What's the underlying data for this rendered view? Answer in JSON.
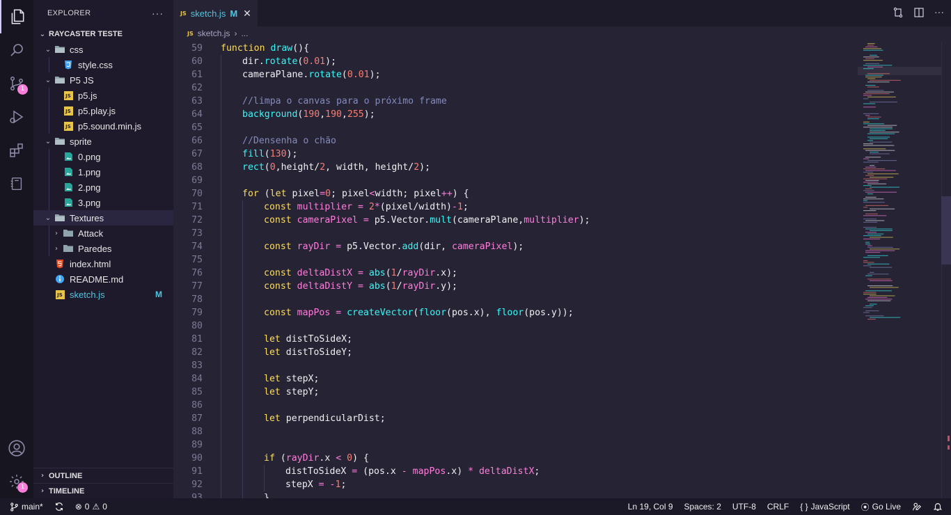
{
  "explorer": {
    "title": "EXPLORER",
    "more": "···",
    "workspace": "RAYCASTER TESTE",
    "tree": [
      {
        "name": "css",
        "kind": "folder-open",
        "depth": 1
      },
      {
        "name": "style.css",
        "kind": "css",
        "depth": 2
      },
      {
        "name": "P5 JS",
        "kind": "folder-open",
        "depth": 1
      },
      {
        "name": "p5.js",
        "kind": "js",
        "depth": 2
      },
      {
        "name": "p5.play.js",
        "kind": "js",
        "depth": 2
      },
      {
        "name": "p5.sound.min.js",
        "kind": "js",
        "depth": 2
      },
      {
        "name": "sprite",
        "kind": "folder-open",
        "depth": 1
      },
      {
        "name": "0.png",
        "kind": "png",
        "depth": 2
      },
      {
        "name": "1.png",
        "kind": "png",
        "depth": 2
      },
      {
        "name": "2.png",
        "kind": "png",
        "depth": 2
      },
      {
        "name": "3.png",
        "kind": "png",
        "depth": 2
      },
      {
        "name": "Textures",
        "kind": "folder-open",
        "depth": 1,
        "selected": true
      },
      {
        "name": "Attack",
        "kind": "folder",
        "depth": 2
      },
      {
        "name": "Paredes",
        "kind": "folder",
        "depth": 2
      },
      {
        "name": "index.html",
        "kind": "html",
        "depth": 1
      },
      {
        "name": "README.md",
        "kind": "info",
        "depth": 1
      },
      {
        "name": "sketch.js",
        "kind": "js",
        "depth": 1,
        "modified": "M"
      }
    ],
    "outline": "OUTLINE",
    "timeline": "TIMELINE"
  },
  "activity": {
    "icons": [
      "files-icon",
      "search-icon",
      "source-control-icon",
      "run-debug-icon",
      "extensions-icon",
      "notebook-icon",
      "account-icon",
      "settings-gear-icon"
    ],
    "scm_badge": "1",
    "settings_badge": "1"
  },
  "tab": {
    "icon_text": "JS",
    "name": "sketch.js",
    "modified": "M",
    "close": "✕"
  },
  "breadcrumb": {
    "icon_text": "JS",
    "file": "sketch.js",
    "sep": "›",
    "more": "..."
  },
  "code": {
    "lines": [
      {
        "n": "59",
        "t": [
          [
            "kw",
            "function "
          ],
          [
            "fn",
            "draw"
          ],
          [
            "vr",
            "(){"
          ]
        ]
      },
      {
        "n": "60",
        "i": 1,
        "t": [
          [
            "vr",
            "dir."
          ],
          [
            "fn",
            "rotate"
          ],
          [
            "vr",
            "("
          ],
          [
            "num",
            "0.01"
          ],
          [
            "vr",
            ");"
          ]
        ]
      },
      {
        "n": "61",
        "i": 1,
        "t": [
          [
            "vr",
            "cameraPlane."
          ],
          [
            "fn",
            "rotate"
          ],
          [
            "vr",
            "("
          ],
          [
            "num",
            "0.01"
          ],
          [
            "vr",
            ");"
          ]
        ]
      },
      {
        "n": "62",
        "i": 1,
        "t": []
      },
      {
        "n": "63",
        "i": 1,
        "t": [
          [
            "cm",
            "//limpa o canvas para o próximo frame"
          ]
        ]
      },
      {
        "n": "64",
        "i": 1,
        "t": [
          [
            "fn",
            "background"
          ],
          [
            "vr",
            "("
          ],
          [
            "num",
            "190"
          ],
          [
            "vr",
            ","
          ],
          [
            "num",
            "190"
          ],
          [
            "vr",
            ","
          ],
          [
            "num",
            "255"
          ],
          [
            "vr",
            ");"
          ]
        ]
      },
      {
        "n": "65",
        "i": 1,
        "t": []
      },
      {
        "n": "66",
        "i": 1,
        "t": [
          [
            "cm",
            "//Densenha o chão"
          ]
        ]
      },
      {
        "n": "67",
        "i": 1,
        "t": [
          [
            "fn",
            "fill"
          ],
          [
            "vr",
            "("
          ],
          [
            "num",
            "130"
          ],
          [
            "vr",
            ");"
          ]
        ]
      },
      {
        "n": "68",
        "i": 1,
        "t": [
          [
            "fn",
            "rect"
          ],
          [
            "vr",
            "("
          ],
          [
            "num",
            "0"
          ],
          [
            "vr",
            ",height/"
          ],
          [
            "num",
            "2"
          ],
          [
            "vr",
            ", width, height/"
          ],
          [
            "num",
            "2"
          ],
          [
            "vr",
            ");"
          ]
        ]
      },
      {
        "n": "69",
        "i": 1,
        "t": []
      },
      {
        "n": "70",
        "i": 1,
        "t": [
          [
            "kw",
            "for "
          ],
          [
            "vr",
            "("
          ],
          [
            "kw",
            "let "
          ],
          [
            "vr",
            "pixel"
          ],
          [
            "op",
            "="
          ],
          [
            "num",
            "0"
          ],
          [
            "vr",
            "; pixel"
          ],
          [
            "op",
            "<"
          ],
          [
            "vr",
            "width; pixel"
          ],
          [
            "op",
            "++"
          ],
          [
            "vr",
            ") {"
          ]
        ]
      },
      {
        "n": "71",
        "i": 2,
        "t": [
          [
            "kw",
            "const "
          ],
          [
            "pm",
            "multiplier"
          ],
          [
            "op",
            " = "
          ],
          [
            "num",
            "2"
          ],
          [
            "op",
            "*"
          ],
          [
            "vr",
            "(pixel/width)"
          ],
          [
            "op",
            "-"
          ],
          [
            "num",
            "1"
          ],
          [
            "vr",
            ";"
          ]
        ]
      },
      {
        "n": "72",
        "i": 2,
        "t": [
          [
            "kw",
            "const "
          ],
          [
            "pm",
            "cameraPixel"
          ],
          [
            "op",
            " = "
          ],
          [
            "vr",
            "p5.Vector."
          ],
          [
            "fn",
            "mult"
          ],
          [
            "vr",
            "(cameraPlane,"
          ],
          [
            "pm",
            "multiplier"
          ],
          [
            "vr",
            ");"
          ]
        ]
      },
      {
        "n": "73",
        "i": 2,
        "t": []
      },
      {
        "n": "74",
        "i": 2,
        "t": [
          [
            "kw",
            "const "
          ],
          [
            "pm",
            "rayDir"
          ],
          [
            "op",
            " = "
          ],
          [
            "vr",
            "p5.Vector."
          ],
          [
            "fn",
            "add"
          ],
          [
            "vr",
            "(dir, "
          ],
          [
            "pm",
            "cameraPixel"
          ],
          [
            "vr",
            ");"
          ]
        ]
      },
      {
        "n": "75",
        "i": 2,
        "t": []
      },
      {
        "n": "76",
        "i": 2,
        "t": [
          [
            "kw",
            "const "
          ],
          [
            "pm",
            "deltaDistX"
          ],
          [
            "op",
            " = "
          ],
          [
            "fn",
            "abs"
          ],
          [
            "vr",
            "("
          ],
          [
            "num",
            "1"
          ],
          [
            "vr",
            "/"
          ],
          [
            "pm",
            "rayDir"
          ],
          [
            "vr",
            ".x);"
          ]
        ]
      },
      {
        "n": "77",
        "i": 2,
        "t": [
          [
            "kw",
            "const "
          ],
          [
            "pm",
            "deltaDistY"
          ],
          [
            "op",
            " = "
          ],
          [
            "fn",
            "abs"
          ],
          [
            "vr",
            "("
          ],
          [
            "num",
            "1"
          ],
          [
            "vr",
            "/"
          ],
          [
            "pm",
            "rayDir"
          ],
          [
            "vr",
            ".y);"
          ]
        ]
      },
      {
        "n": "78",
        "i": 2,
        "t": []
      },
      {
        "n": "79",
        "i": 2,
        "t": [
          [
            "kw",
            "const "
          ],
          [
            "pm",
            "mapPos"
          ],
          [
            "op",
            " = "
          ],
          [
            "fn",
            "createVector"
          ],
          [
            "vr",
            "("
          ],
          [
            "fn",
            "floor"
          ],
          [
            "vr",
            "(pos.x), "
          ],
          [
            "fn",
            "floor"
          ],
          [
            "vr",
            "(pos.y));"
          ]
        ]
      },
      {
        "n": "80",
        "i": 2,
        "t": []
      },
      {
        "n": "81",
        "i": 2,
        "t": [
          [
            "kw",
            "let "
          ],
          [
            "vr",
            "distToSideX;"
          ]
        ]
      },
      {
        "n": "82",
        "i": 2,
        "t": [
          [
            "kw",
            "let "
          ],
          [
            "vr",
            "distToSideY;"
          ]
        ]
      },
      {
        "n": "83",
        "i": 2,
        "t": []
      },
      {
        "n": "84",
        "i": 2,
        "t": [
          [
            "kw",
            "let "
          ],
          [
            "vr",
            "stepX;"
          ]
        ]
      },
      {
        "n": "85",
        "i": 2,
        "t": [
          [
            "kw",
            "let "
          ],
          [
            "vr",
            "stepY;"
          ]
        ]
      },
      {
        "n": "86",
        "i": 2,
        "t": []
      },
      {
        "n": "87",
        "i": 2,
        "t": [
          [
            "kw",
            "let "
          ],
          [
            "vr",
            "perpendicularDist;"
          ]
        ]
      },
      {
        "n": "88",
        "i": 2,
        "t": []
      },
      {
        "n": "89",
        "i": 2,
        "t": []
      },
      {
        "n": "90",
        "i": 2,
        "t": [
          [
            "kw",
            "if "
          ],
          [
            "vr",
            "("
          ],
          [
            "pm",
            "rayDir"
          ],
          [
            "vr",
            ".x "
          ],
          [
            "op",
            "<"
          ],
          [
            "vr",
            " "
          ],
          [
            "num",
            "0"
          ],
          [
            "vr",
            ") {"
          ]
        ]
      },
      {
        "n": "91",
        "i": 3,
        "t": [
          [
            "vr",
            "distToSideX "
          ],
          [
            "op",
            "="
          ],
          [
            "vr",
            " (pos.x "
          ],
          [
            "op",
            "-"
          ],
          [
            "vr",
            " "
          ],
          [
            "pm",
            "mapPos"
          ],
          [
            "vr",
            ".x) "
          ],
          [
            "op",
            "*"
          ],
          [
            "vr",
            " "
          ],
          [
            "pm",
            "deltaDistX"
          ],
          [
            "vr",
            ";"
          ]
        ]
      },
      {
        "n": "92",
        "i": 3,
        "t": [
          [
            "vr",
            "stepX "
          ],
          [
            "op",
            "="
          ],
          [
            "vr",
            " "
          ],
          [
            "op",
            "-"
          ],
          [
            "num",
            "1"
          ],
          [
            "vr",
            ";"
          ]
        ]
      },
      {
        "n": "93",
        "i": 2,
        "t": [
          [
            "vr",
            "}"
          ]
        ]
      }
    ]
  },
  "status": {
    "branch": "main*",
    "errors": "0",
    "warnings": "0",
    "position": "Ln 19, Col 9",
    "spaces": "Spaces: 2",
    "encoding": "UTF-8",
    "eol": "CRLF",
    "language": "JavaScript",
    "golive": "Go Live"
  },
  "colors": {
    "accent": "#ff7edb",
    "keyword": "#fede5d",
    "function": "#36f9f6",
    "number": "#f97e72",
    "comment": "#848bbd",
    "modified": "#4fc6e0"
  }
}
